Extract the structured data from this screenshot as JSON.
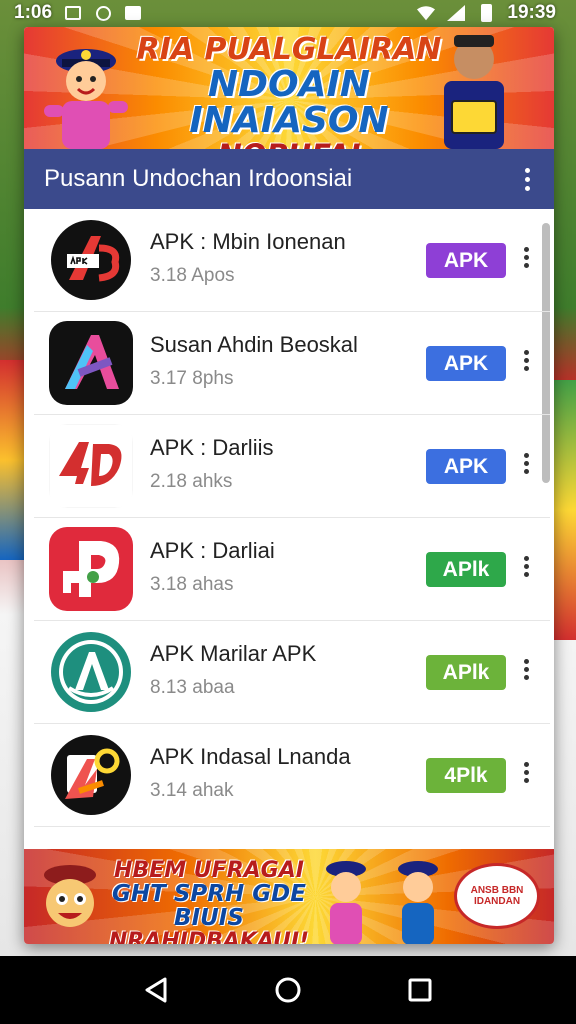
{
  "status_bar": {
    "time": "1:06",
    "clock_right": "19:39",
    "icons": [
      "image-icon",
      "circle-icon",
      "message-icon",
      "wifi-icon",
      "signal-icon",
      "battery-icon"
    ]
  },
  "banner_top": {
    "line1": "RIA PUALGLAIRAN",
    "line2": "NDOAIN INAIASON",
    "line3": "NOPUFAI HIDOOMGA!"
  },
  "header": {
    "title": "Pusann Undochan Irdoonsiai"
  },
  "apps": [
    {
      "name": "APK : Mbin Ionenan",
      "meta": "3.18 Apos",
      "button": "APK",
      "button_color": "#8e3fd6",
      "icon": "apk-logo-icon"
    },
    {
      "name": "Susan Ahdin Beoskal",
      "meta": "3.17 8phs",
      "button": "APK",
      "button_color": "#3c6fe0",
      "icon": "a-arrow-logo-icon"
    },
    {
      "name": "APK : Darliis",
      "meta": "2.18 ahks",
      "button": "APK",
      "button_color": "#3c6fe0",
      "icon": "red-4d-logo-icon"
    },
    {
      "name": "APK : Darliai",
      "meta": "3.18 ahas",
      "button": "APlk",
      "button_color": "#2ea84a",
      "icon": "red-p-logo-icon"
    },
    {
      "name": "APK Marilar APK",
      "meta": "8.13 abaa",
      "button": "APlk",
      "button_color": "#6cb33a",
      "icon": "green-seal-logo-icon"
    },
    {
      "name": "APK Indasal Lnanda",
      "meta": "3.14 ahak",
      "button": "4Plk",
      "button_color": "#6cb33a",
      "icon": "flame-logo-icon"
    }
  ],
  "banner_bottom": {
    "line1": "HBEM UFRAGAI",
    "line2": "GHT SPRH GDE BIUIS",
    "line3": "NRAHIDBAKAUI!",
    "badge": "ANSB BBN IDANDAN"
  },
  "nav": {
    "back": "back-icon",
    "home": "home-icon",
    "recents": "recents-icon"
  }
}
